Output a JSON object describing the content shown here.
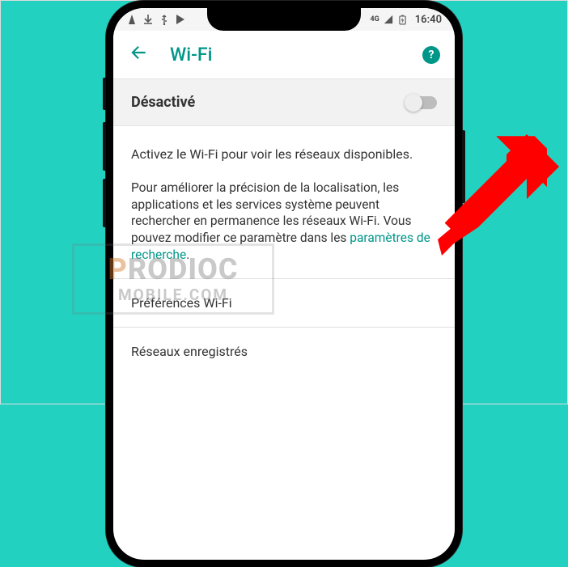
{
  "status_bar": {
    "network_label": "4G",
    "time": "16:40"
  },
  "app_bar": {
    "title": "Wi-Fi"
  },
  "toggle": {
    "label": "Désactivé",
    "on": false
  },
  "content": {
    "hint": "Activez le Wi-Fi pour voir les réseaux disponibles.",
    "desc_part1": "Pour améliorer la précision de la localisation, les applications et les services système peuvent rechercher en permanence les réseaux Wi-Fi. Vous pouvez modifier ce paramètre dans les ",
    "link_text": "paramètres de recherche",
    "desc_part2": "."
  },
  "list": {
    "item1": "Préférences Wi-Fi",
    "item2": "Réseaux enregistrés"
  },
  "watermark": {
    "line1a": "P",
    "line1b": "RODIOC",
    "line2": "MOBILE.COM"
  },
  "colors": {
    "accent": "#009688",
    "bg": "#23d1c1",
    "arrow": "#ff0000"
  }
}
